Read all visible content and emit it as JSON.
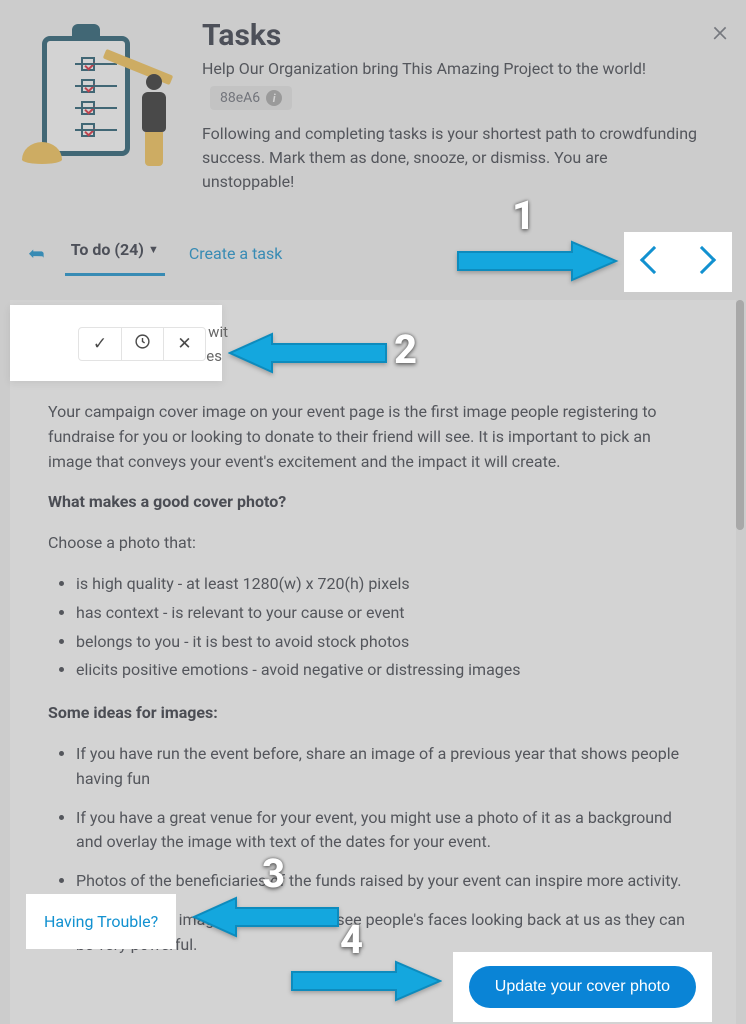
{
  "header": {
    "title": "Tasks",
    "subtitle": "Help Our Organization bring This Amazing Project to the world!",
    "code": "88eA6",
    "blurb": "Following and completing tasks is your shortest path to crowdfunding success. Mark them as done, snooze, or dismiss. You are unstoppable!"
  },
  "tabs": {
    "todo_label": "To do (24)",
    "create_label": "Create a task"
  },
  "popover": {
    "side_text": "wit",
    "side_text2": "es"
  },
  "content": {
    "intro": "Your campaign cover image on your event page is the first image people registering to fundraise for you or looking to donate to their friend will see. It is important to pick an image that conveys your event's excitement and the impact it will create.",
    "q1": "What makes a good cover photo?",
    "choose": "Choose a photo that:",
    "good": [
      "is high quality - at least 1280(w) x 720(h) pixels",
      "has context - is relevant to your cause or event",
      "belongs to you - it is best to avoid stock photos",
      "elicits positive emotions  - avoid negative or distressing images"
    ],
    "q2": "Some ideas for images:",
    "ideas": [
      "If you have run the event before, share an image of a previous year that shows people having fun",
      "If you have a great venue for your event, you might use a photo of it as a background and overlay the image with text of the dates for your event.",
      "Photos of the beneficiaries of the funds raised by your event can inspire more activity.",
      "If you can use images where we can see people's faces looking back at us as they can be very powerful."
    ]
  },
  "trouble": "Having Trouble?",
  "cta": "Update your cover photo",
  "annotations": {
    "n1": "1",
    "n2": "2",
    "n3": "3",
    "n4": "4"
  }
}
